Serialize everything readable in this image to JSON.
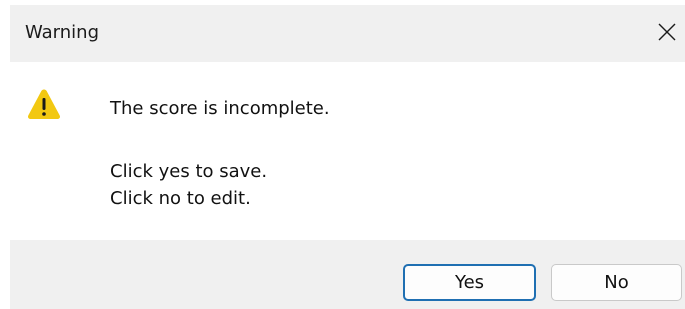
{
  "window": {
    "title": "Warning",
    "close_icon": "close-icon"
  },
  "content": {
    "icon": "warning-icon",
    "icon_color": "#f2c811",
    "message": "The score is incomplete.",
    "line_yes": "Click yes to save.",
    "line_no": "Click no to edit."
  },
  "buttons": {
    "yes_label": "Yes",
    "no_label": "No",
    "default_border_color": "#1f6fb2"
  }
}
